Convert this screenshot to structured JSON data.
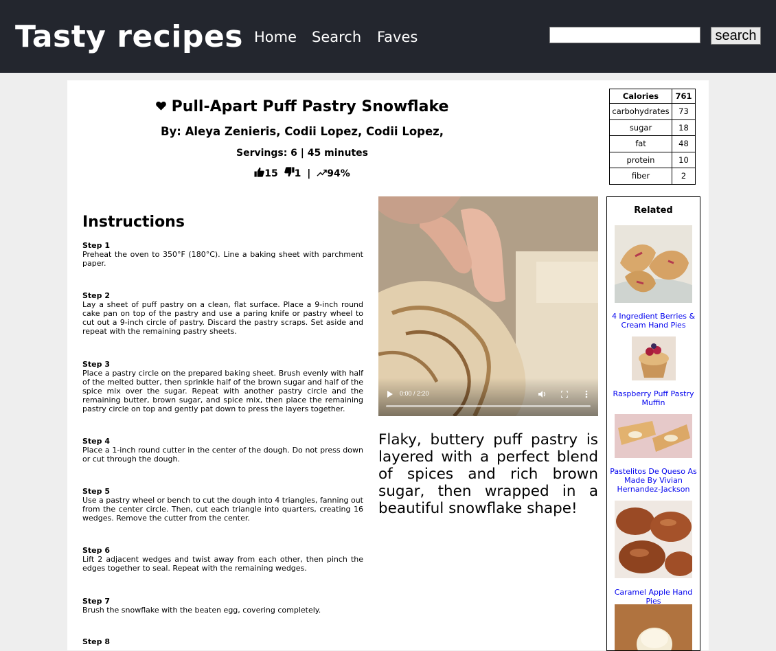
{
  "header": {
    "brand": "Tasty recipes",
    "nav": [
      "Home",
      "Search",
      "Faves"
    ],
    "search_placeholder": "",
    "search_button": "search"
  },
  "recipe": {
    "title": "Pull-Apart Puff Pastry Snowflake",
    "heart_icon": "heart-icon",
    "authors": "By: Aleya Zenieris, Codii Lopez, Codii Lopez,",
    "servings": "Servings: 6 | 45 minutes",
    "thumbs_up": "15",
    "thumbs_down": "1",
    "separator": "|",
    "score": "94%",
    "description": "Flaky, buttery puff pastry is layered with a perfect blend of spices and rich brown sugar, then wrapped in a beautiful snowflake shape!"
  },
  "nutrition": {
    "head": {
      "label": "Calories",
      "value": "761"
    },
    "rows": [
      {
        "label": "carbohydrates",
        "value": "73"
      },
      {
        "label": "sugar",
        "value": "18"
      },
      {
        "label": "fat",
        "value": "48"
      },
      {
        "label": "protein",
        "value": "10"
      },
      {
        "label": "fiber",
        "value": "2"
      }
    ]
  },
  "instructions": {
    "heading": "Instructions",
    "steps": [
      {
        "label": "Step 1",
        "text": "Preheat the oven to 350°F (180°C). Line a baking sheet with parchment paper."
      },
      {
        "label": "Step 2",
        "text": "Lay a sheet of puff pastry on a clean, flat surface. Place a 9-inch round cake pan on top of the pastry and use a paring knife or pastry wheel to cut out a 9-inch circle of pastry. Discard the pastry scraps. Set aside and repeat with the remaining pastry sheets."
      },
      {
        "label": "Step 3",
        "text": "Place a pastry circle on the prepared baking sheet. Brush evenly with half of the melted butter, then sprinkle half of the brown sugar and half of the spice mix over the sugar. Repeat with another pastry circle and the remaining butter, brown sugar, and spice mix, then place the remaining pastry circle on top and gently pat down to press the layers together."
      },
      {
        "label": "Step 4",
        "text": "Place a 1-inch round cutter in the center of the dough. Do not press down or cut through the dough."
      },
      {
        "label": "Step 5",
        "text": "Use a pastry wheel or bench to cut the dough into 4 triangles, fanning out from the center circle. Then, cut each triangle into quarters, creating 16 wedges. Remove the cutter from the center."
      },
      {
        "label": "Step 6",
        "text": "Lift 2 adjacent wedges and twist away from each other, then pinch the edges together to seal. Repeat with the remaining wedges."
      },
      {
        "label": "Step 7",
        "text": "Brush the snowflake with the beaten egg, covering completely."
      },
      {
        "label": "Step 8",
        "text": ""
      }
    ]
  },
  "video": {
    "time": "0:00 / 2:20",
    "progress": 0
  },
  "related": {
    "title": "Related",
    "items": [
      {
        "title": "4 Ingredient Berries & Cream Hand Pies"
      },
      {
        "title": "Raspberry Puff Pastry Muffin"
      },
      {
        "title": "Pastelitos De Queso As Made By Vivian Hernandez-Jackson"
      },
      {
        "title": "Caramel Apple Hand Pies"
      },
      {
        "title": ""
      }
    ]
  },
  "colors": {
    "header_bg": "#23262e",
    "page_bg": "#eeeeee",
    "link": "#0000ee"
  }
}
